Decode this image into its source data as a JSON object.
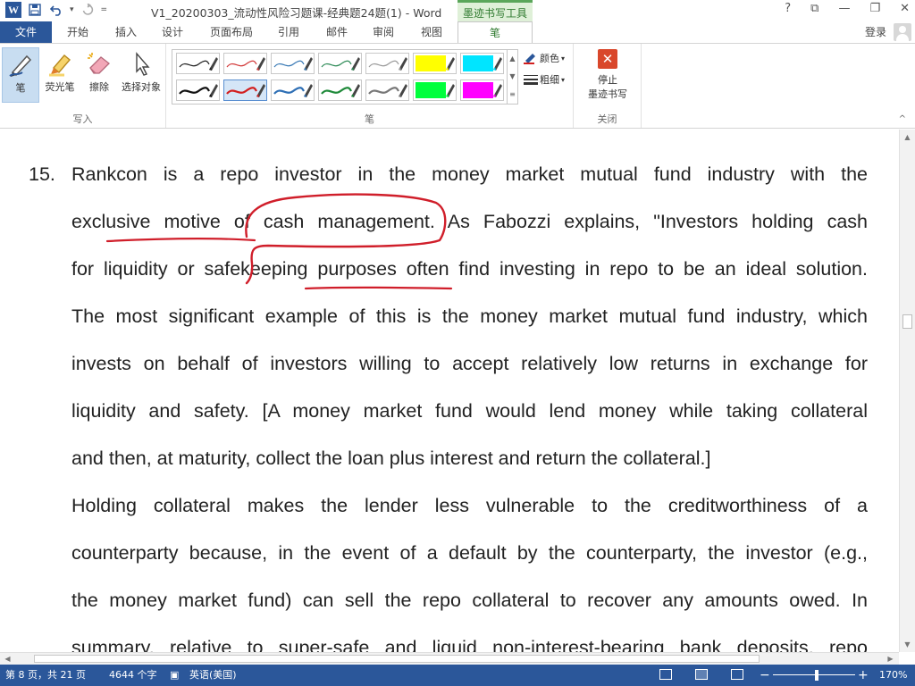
{
  "titlebar": {
    "title": "V1_20200303_流动性风险习题课-经典题24题(1) - Word",
    "context_tab_group": "墨迹书写工具",
    "help": "?",
    "ribbon_display": "⧉",
    "minimize": "—",
    "restore": "❐",
    "close": "✕",
    "qat": {
      "logo": "W",
      "save_icon": "save-icon",
      "undo_icon": "undo-icon",
      "redo_icon": "redo-icon",
      "dropdown": "▾",
      "customize": "="
    }
  },
  "tabs": [
    {
      "label": "文件"
    },
    {
      "label": "开始"
    },
    {
      "label": "插入"
    },
    {
      "label": "设计"
    },
    {
      "label": "页面布局"
    },
    {
      "label": "引用"
    },
    {
      "label": "邮件"
    },
    {
      "label": "审阅"
    },
    {
      "label": "视图"
    },
    {
      "label": "笔"
    }
  ],
  "account": {
    "login": "登录"
  },
  "ribbon": {
    "write_group": {
      "label": "写入",
      "buttons": [
        {
          "label": "笔",
          "icon": "pen-icon",
          "selected": true
        },
        {
          "label": "荧光笔",
          "icon": "highlighter-icon",
          "selected": false
        },
        {
          "label": "擦除",
          "icon": "eraser-icon",
          "selected": false
        },
        {
          "label": "选择对象",
          "icon": "select-objects-icon",
          "selected": false
        }
      ]
    },
    "pen_group": {
      "label": "笔",
      "pens": [
        {
          "color": "#222222",
          "kind": "thin"
        },
        {
          "color": "#d23a3a",
          "kind": "thin"
        },
        {
          "color": "#3a7ab5",
          "kind": "thin"
        },
        {
          "color": "#2e8b57",
          "kind": "thin"
        },
        {
          "color": "#9a9a9a",
          "kind": "thin"
        },
        {
          "color": "#ffff00",
          "kind": "highlighter"
        },
        {
          "color": "#00e5ff",
          "kind": "highlighter"
        },
        {
          "color": "#111111",
          "kind": "thick"
        },
        {
          "color": "#d21f1f",
          "kind": "thick",
          "selected": true
        },
        {
          "color": "#2e6fb5",
          "kind": "thick"
        },
        {
          "color": "#1f8a3a",
          "kind": "thick"
        },
        {
          "color": "#777777",
          "kind": "thick"
        },
        {
          "color": "#00ff3c",
          "kind": "highlighter"
        },
        {
          "color": "#ff00ff",
          "kind": "highlighter"
        }
      ],
      "color_label": "颜色",
      "thickness_label": "粗细"
    },
    "close_group": {
      "label": "关闭",
      "stop_label_line1": "停止",
      "stop_label_line2": "墨迹书写"
    },
    "collapse": "^"
  },
  "document": {
    "question_number": "15.",
    "lines": [
      "Rankcon is a repo investor in the money market mutual fund industry with the",
      "exclusive motive of cash management. As Fabozzi explains, \"Investors holding cash",
      "for liquidity or safekeeping purposes often find investing in repo to be an ideal solution.",
      "The most significant example of this is the money market mutual fund industry, which",
      "invests on behalf of investors willing to accept relatively low returns in exchange for",
      "liquidity and safety. [A money market fund would lend money while taking collateral",
      "and then, at maturity, collect the loan plus interest and return the collateral.]",
      "Holding collateral makes the lender less vulnerable to the creditworthiness of a",
      "counterparty because, in the event of a default by the counterparty, the investor (e.g.,",
      "the money market fund) can sell the repo collateral to recover any amounts owed. In",
      "summary, relative to super-safe and liquid non-interest-bearing bank deposits, repo"
    ],
    "ink_color": "#d01e2a"
  },
  "statusbar": {
    "page": "第 8 页，共 21 页",
    "words": "4644 个字",
    "language": "英语(美国)",
    "zoom": "170%",
    "zoom_minus": "−",
    "zoom_plus": "+",
    "zoom_level": 170
  }
}
